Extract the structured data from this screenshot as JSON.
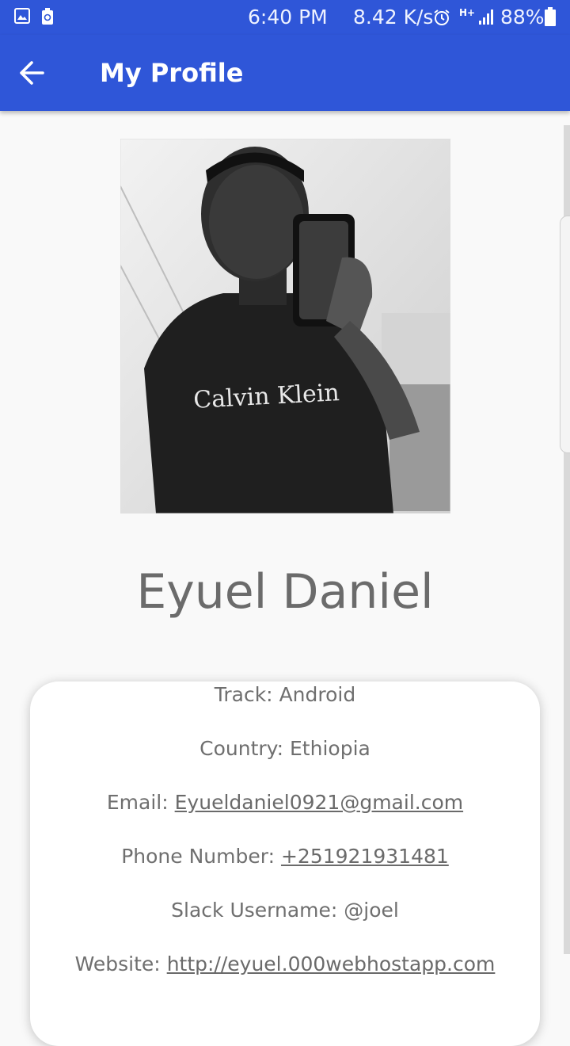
{
  "status_bar": {
    "time": "6:40 PM",
    "speed": "8.42 K/s",
    "network": "H+",
    "battery": "88%",
    "icons": [
      "gallery-icon",
      "recycle-icon",
      "alarm-icon",
      "signal-icon",
      "battery-icon"
    ]
  },
  "app_bar": {
    "title": "My Profile",
    "back_icon": "arrow-left-icon",
    "color": "#2f56d8"
  },
  "profile": {
    "name": "Eyuel Daniel",
    "photo_shirt_text": "Calvin Klein"
  },
  "details": {
    "track_label": "Track:",
    "track_value": "Android",
    "country_label": "Country:",
    "country_value": "Ethiopia",
    "email_label": "Email:",
    "email_value": "Eyueldaniel0921@gmail.com",
    "phone_label": "Phone Number:",
    "phone_value": "+251921931481",
    "slack_label": "Slack Username:",
    "slack_value": "@joel",
    "website_label": "Website:",
    "website_value": "http://eyuel.000webhostapp.com"
  }
}
